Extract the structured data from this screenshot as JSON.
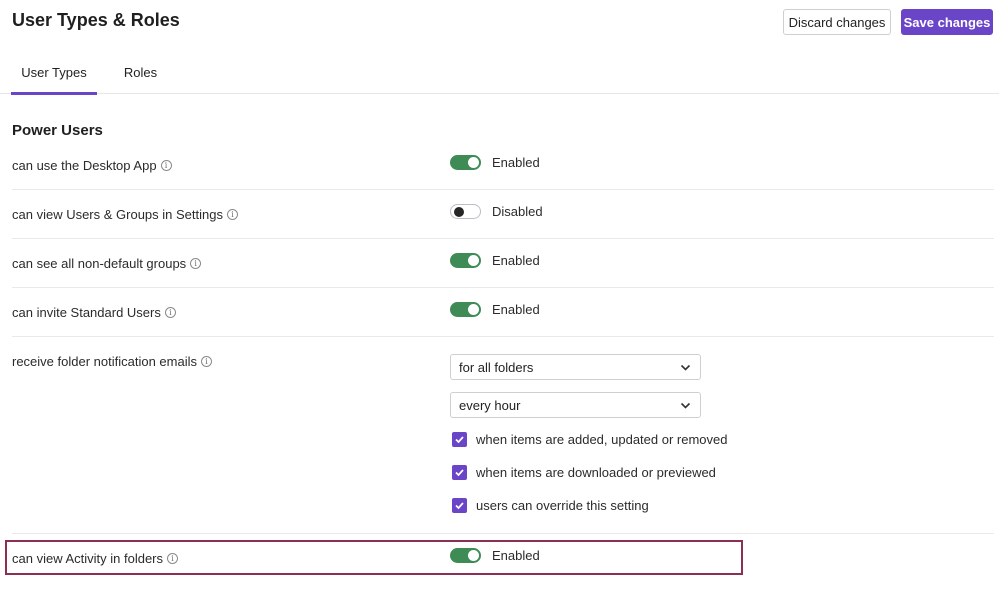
{
  "page": {
    "title": "User Types & Roles"
  },
  "header": {
    "discard_label": "Discard changes",
    "save_label": "Save changes"
  },
  "tabs": [
    {
      "label": "User Types",
      "active": true
    },
    {
      "label": "Roles",
      "active": false
    }
  ],
  "section": {
    "title": "Power Users"
  },
  "info_glyph": "i",
  "settings": [
    {
      "label": "can use the Desktop App",
      "state": "on",
      "status": "Enabled"
    },
    {
      "label": "can view Users & Groups in Settings",
      "state": "off",
      "status": "Disabled"
    },
    {
      "label": "can see all non-default groups",
      "state": "on",
      "status": "Enabled"
    },
    {
      "label": "can invite Standard Users",
      "state": "on",
      "status": "Enabled"
    }
  ],
  "notifications": {
    "label": "receive folder notification emails",
    "scope_select": "for all folders",
    "frequency_select": "every hour",
    "options": [
      {
        "label": "when items are added, updated or removed",
        "checked": true
      },
      {
        "label": "when items are downloaded or previewed",
        "checked": true
      },
      {
        "label": "users can override this setting",
        "checked": true
      }
    ]
  },
  "activity": {
    "label": "can view Activity in folders",
    "state": "on",
    "status": "Enabled"
  },
  "colors": {
    "accent": "#6b45c8",
    "toggle_on": "#3f8b56",
    "highlight_border": "#8c2f55"
  }
}
